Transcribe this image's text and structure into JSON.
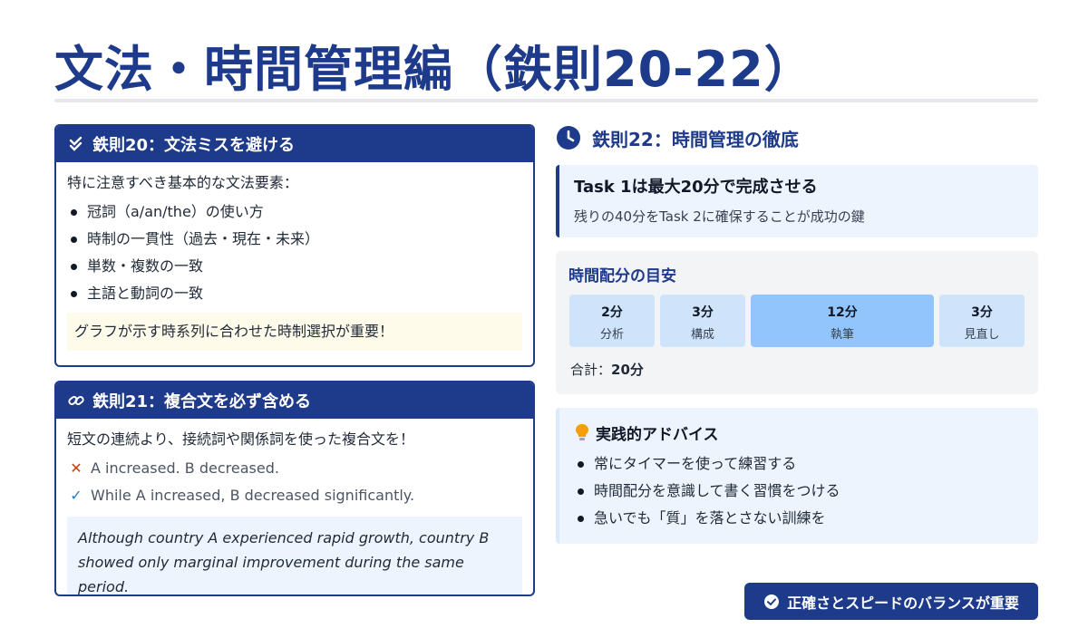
{
  "page": {
    "title": "文法・時間管理編（鉄則20-22）"
  },
  "rule20": {
    "icon": "double-check-icon",
    "heading": "鉄則20：文法ミスを避ける",
    "intro": "特に注意すべき基本的な文法要素：",
    "items": [
      "冠詞（a/an/the）の使い方",
      "時制の一貫性（過去・現在・未来）",
      "単数・複数の一致",
      "主語と動詞の一致"
    ],
    "note": "グラフが示す時系列に合わせた時制選択が重要！"
  },
  "rule21": {
    "icon": "link-icon",
    "heading": "鉄則21：複合文を必ず含める",
    "intro": "短文の連続より、接続詞や関係詞を使った複合文を！",
    "bad_example": "A increased. B decreased.",
    "good_example": "While A increased, B decreased significantly.",
    "quote": "Although country A experienced rapid growth, country B showed only marginal improvement during the same period."
  },
  "rule22": {
    "icon": "clock-icon",
    "heading": "鉄則22：時間管理の徹底",
    "task_title": "Task 1は最大20分で完成させる",
    "task_sub": "残りの40分をTask 2に確保することが成功の鍵",
    "allocation": {
      "heading": "時間配分の目安",
      "segments": [
        {
          "value": "2分",
          "label": "分析",
          "minutes": 2
        },
        {
          "value": "3分",
          "label": "構成",
          "minutes": 3
        },
        {
          "value": "12分",
          "label": "執筆",
          "minutes": 12
        },
        {
          "value": "3分",
          "label": "見直し",
          "minutes": 3
        }
      ],
      "total_label": "合計：",
      "total_value": "20分"
    },
    "advice": {
      "icon": "lightbulb-icon",
      "heading": "実践的アドバイス",
      "items": [
        "常にタイマーを使って練習する",
        "時間配分を意識して書く習慣をつける",
        "急いでも「質」を落とさない訓練を"
      ]
    }
  },
  "cta": {
    "icon": "check-circle-icon",
    "label": "正確さとスピードのバランスが重要"
  },
  "colors": {
    "navy": "#1e3a8a",
    "light_blue": "#cfe3fb",
    "highlight_blue": "#93c5fd",
    "note_yellow": "#fffbea",
    "bad_mark": "#c2410c",
    "good_mark": "#2b7bb9"
  }
}
